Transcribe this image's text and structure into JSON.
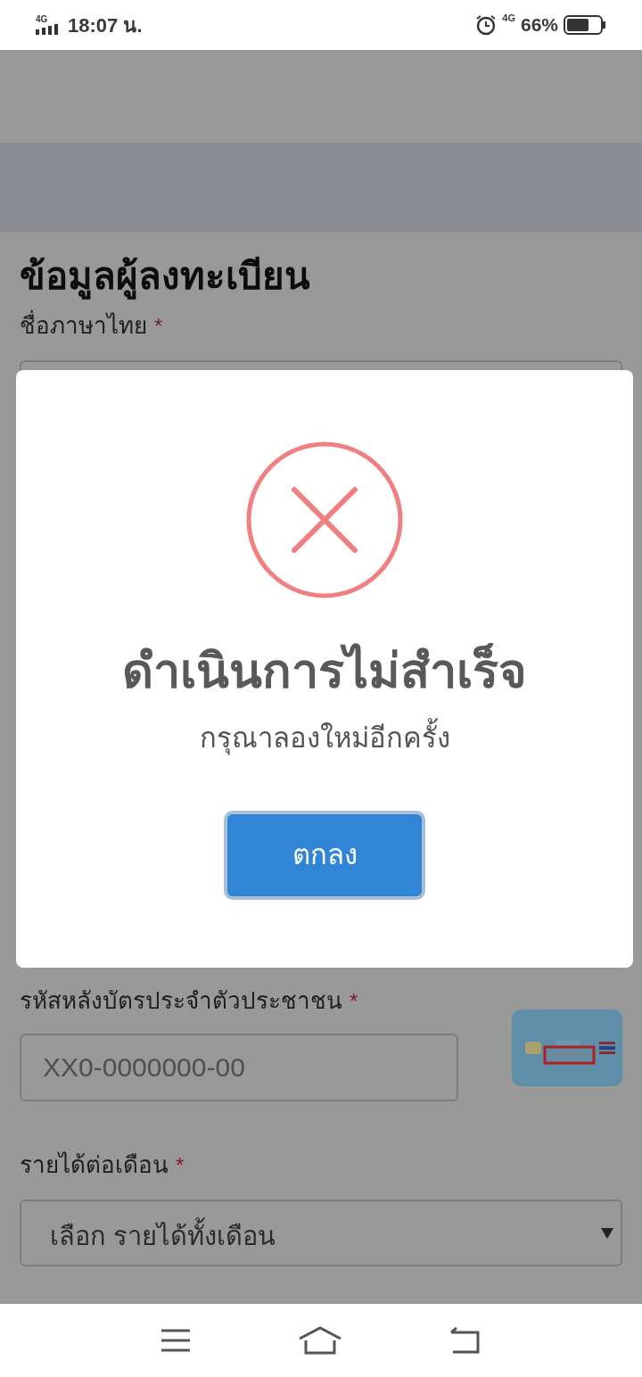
{
  "status_bar": {
    "network_left": "4G",
    "time": "18:07 น.",
    "network_right": "4G",
    "battery": "66%"
  },
  "form": {
    "title": "ข้อมูลผู้ลงทะเบียน",
    "fields": [
      {
        "kind": "text",
        "label": "ชื่อภาษาไทย",
        "required_mark": "*"
      },
      {
        "kind": "id_text",
        "label": "รหัสหลังบัตรประจำตัวประชาชน",
        "required_mark": "*",
        "placeholder": "XX0-0000000-00"
      },
      {
        "kind": "select",
        "label": "รายได้ต่อเดือน",
        "required_mark": "*",
        "value": "เลือก รายได้ทั้งเดือน"
      }
    ]
  },
  "dialog": {
    "kind": "error",
    "title": "ดำเนินการไม่สำเร็จ",
    "message": "กรุณาลองใหม่อีกครั้ง",
    "button": "ตกลง"
  }
}
